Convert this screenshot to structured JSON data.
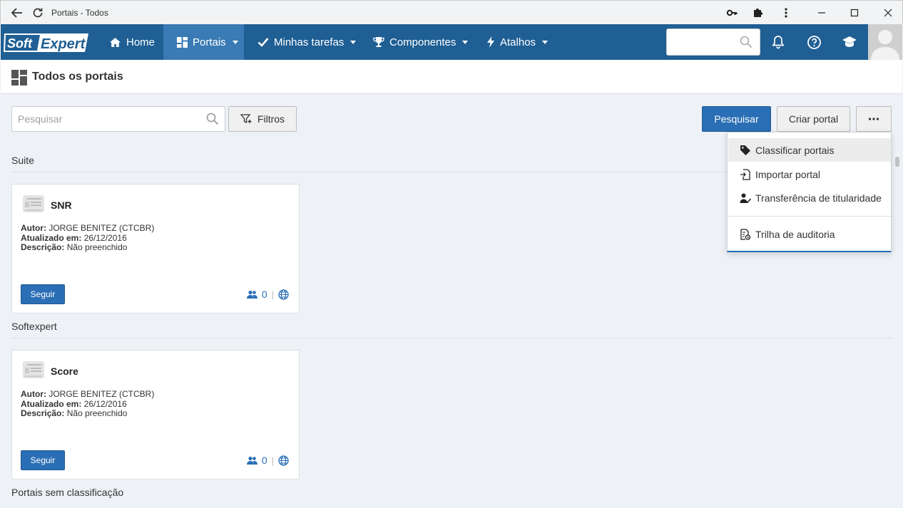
{
  "window": {
    "title": "Portais - Todos"
  },
  "nav": {
    "logo": "SoftExpert",
    "items": [
      {
        "label": "Home",
        "icon": "home-icon"
      },
      {
        "label": "Portais",
        "icon": "dashboard-icon",
        "active": true
      },
      {
        "label": "Minhas tarefas",
        "icon": "check-icon"
      },
      {
        "label": "Componentes",
        "icon": "trophy-icon"
      },
      {
        "label": "Atalhos",
        "icon": "bolt-icon"
      }
    ],
    "search_value": ""
  },
  "page": {
    "title": "Todos os portais"
  },
  "toolbar": {
    "search_placeholder": "Pesquisar",
    "filters_label": "Filtros",
    "search_button": "Pesquisar",
    "create_button": "Criar portal",
    "more_button": "···"
  },
  "sections": [
    {
      "label": "Suite",
      "card": {
        "name": "SNR",
        "author_label": "Autor:",
        "author": "JORGE BENITEZ (CTCBR)",
        "updated_label": "Atualizado em:",
        "updated": "26/12/2016",
        "description_label": "Descrição:",
        "description": "Não preenchido",
        "follow_label": "Seguir",
        "followers": "0"
      }
    },
    {
      "label": "Softexpert",
      "card": {
        "name": "Score",
        "author_label": "Autor:",
        "author": "JORGE BENITEZ (CTCBR)",
        "updated_label": "Atualizado em:",
        "updated": "26/12/2016",
        "description_label": "Descrição:",
        "description": "Não preenchido",
        "follow_label": "Seguir",
        "followers": "0"
      }
    },
    {
      "label": "Portais sem classificação"
    }
  ],
  "dropdown": {
    "items": [
      {
        "label": "Classificar portais",
        "icon": "tag-icon"
      },
      {
        "label": "Importar portal",
        "icon": "import-icon"
      },
      {
        "label": "Transferência de titularidade",
        "icon": "user-transfer-icon"
      },
      {
        "label": "Trilha de auditoria",
        "icon": "audit-trail-icon"
      }
    ]
  },
  "colors": {
    "nav_bg": "#1f5f94",
    "nav_active": "#3a7ab5",
    "primary": "#2a6eb5",
    "page_bg": "#eef1f6"
  }
}
